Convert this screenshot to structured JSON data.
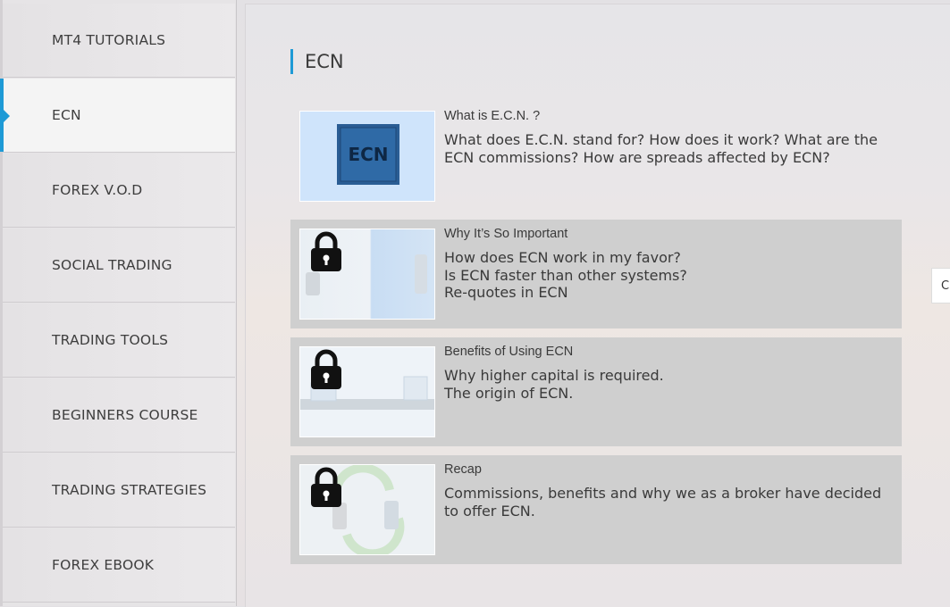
{
  "sidebar": {
    "items": [
      {
        "label": "MT4 TUTORIALS",
        "active": false
      },
      {
        "label": "ECN",
        "active": true
      },
      {
        "label": "FOREX V.O.D",
        "active": false
      },
      {
        "label": "SOCIAL TRADING",
        "active": false
      },
      {
        "label": "TRADING TOOLS",
        "active": false
      },
      {
        "label": "BEGINNERS COURSE",
        "active": false
      },
      {
        "label": "TRADING STRATEGIES",
        "active": false
      },
      {
        "label": "FOREX EBOOK",
        "active": false
      }
    ]
  },
  "main": {
    "title": "ECN",
    "lessons": [
      {
        "title": "What is E.C.N. ?",
        "lines": [
          "What does E.C.N. stand for? How does it work? What are the ECN commissions? How are spreads affected by ECN?"
        ],
        "locked": false,
        "thumb_icon": "ecn-logo-icon",
        "thumb_text": "ECN"
      },
      {
        "title": "Why It’s So Important",
        "lines": [
          "How does ECN work in my favor?",
          "Is ECN faster than other systems?",
          "Re-quotes in ECN"
        ],
        "locked": true,
        "thumb_icon": "lock-icon"
      },
      {
        "title": "Benefits of Using ECN",
        "lines": [
          "Why higher capital is required.",
          "The origin of ECN."
        ],
        "locked": true,
        "thumb_icon": "lock-icon"
      },
      {
        "title": "Recap",
        "lines": [
          "Commissions, benefits and why we as a broker have decided to offer ECN."
        ],
        "locked": true,
        "thumb_icon": "lock-icon"
      }
    ]
  },
  "edge_tab": {
    "label": "C"
  },
  "colors": {
    "accent": "#1e9ad6",
    "locked_card": "#cfcfcf"
  }
}
